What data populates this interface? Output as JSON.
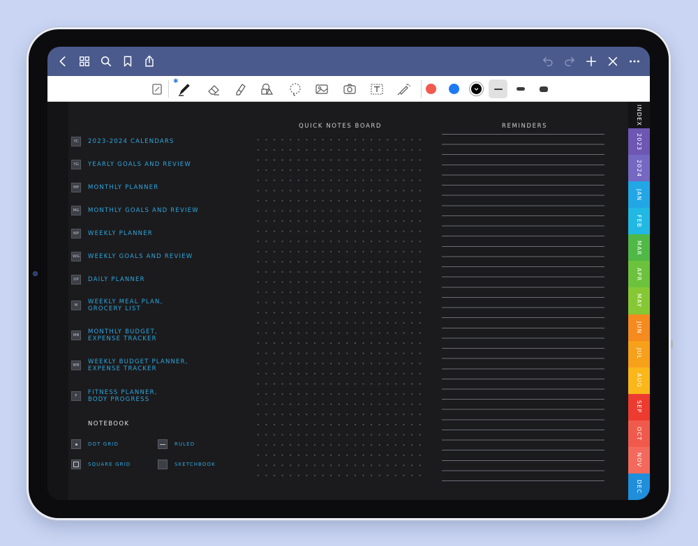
{
  "topbar": {
    "left_icons": [
      "back-icon",
      "grid-icon",
      "search-icon",
      "bookmark-icon",
      "share-icon"
    ],
    "right_icons": [
      "undo-icon",
      "redo-icon",
      "plus-icon",
      "close-icon",
      "more-icon"
    ]
  },
  "toolbar": {
    "tools": [
      "page-view-icon",
      "pen-icon",
      "eraser-icon",
      "highlighter-icon",
      "shapes-icon",
      "lasso-icon",
      "image-icon",
      "camera-icon",
      "text-icon",
      "laser-pointer-icon"
    ],
    "colors": [
      "#f05a4f",
      "#1d7af2",
      "#000000"
    ],
    "selected_color": "#000000",
    "stroke_widths": [
      "thin",
      "medium",
      "thick"
    ]
  },
  "nav": {
    "items": [
      {
        "badge": "YC",
        "lines": [
          "2023-2024 CALENDARS"
        ]
      },
      {
        "badge": "YG",
        "lines": [
          "YEARLY GOALS AND REVIEW"
        ]
      },
      {
        "badge": "MP",
        "lines": [
          "MONTHLY PLANNER"
        ]
      },
      {
        "badge": "MG",
        "lines": [
          "MONTHLY GOALS AND REVIEW"
        ]
      },
      {
        "badge": "WP",
        "lines": [
          "WEEKLY PLANNER"
        ]
      },
      {
        "badge": "WG",
        "lines": [
          "WEEKLY GOALS AND REVIEW"
        ]
      },
      {
        "badge": "DP",
        "lines": [
          "DAILY PLANNER"
        ]
      },
      {
        "badge": "M",
        "lines": [
          "WEEKLY MEAL PLAN,",
          "GROCERY LIST"
        ]
      },
      {
        "badge": "MB",
        "lines": [
          "MONTHLY BUDGET,",
          "EXPENSE TRACKER"
        ]
      },
      {
        "badge": "WB",
        "lines": [
          "WEEKLY BUDGET PLANNER,",
          "EXPENSE TRACKER"
        ]
      },
      {
        "badge": "F",
        "lines": [
          "FITNESS PLANNER,",
          "BODY PROGRESS"
        ]
      }
    ]
  },
  "notebook": {
    "title": "NOTEBOOK",
    "options": [
      {
        "label": "DOT GRID",
        "icon": "dot-grid-icon"
      },
      {
        "label": "RULED",
        "icon": "ruled-icon"
      },
      {
        "label": "SQUARE GRID",
        "icon": "square-grid-icon"
      },
      {
        "label": "SKETCHBOOK",
        "icon": "sketchbook-icon"
      }
    ]
  },
  "board": {
    "title": "QUICK NOTES BOARD"
  },
  "reminders": {
    "title": "REMINDERS"
  },
  "tabs": [
    {
      "label": "INDEX",
      "color": "#141416"
    },
    {
      "label": "2023",
      "color": "#6e56b3"
    },
    {
      "label": "2024",
      "color": "#7468c2"
    },
    {
      "label": "JAN",
      "color": "#22a6e6"
    },
    {
      "label": "FEB",
      "color": "#21b8e4"
    },
    {
      "label": "MAR",
      "color": "#4fb846"
    },
    {
      "label": "APR",
      "color": "#6cc23c"
    },
    {
      "label": "MAY",
      "color": "#86c834"
    },
    {
      "label": "JUN",
      "color": "#f58a1f"
    },
    {
      "label": "JUL",
      "color": "#f7a01a"
    },
    {
      "label": "AUG",
      "color": "#fbb719"
    },
    {
      "label": "SEP",
      "color": "#ee3b30"
    },
    {
      "label": "OCT",
      "color": "#f05a4c"
    },
    {
      "label": "NOV",
      "color": "#f3695c"
    },
    {
      "label": "DEC",
      "color": "#1f8fdc"
    }
  ]
}
